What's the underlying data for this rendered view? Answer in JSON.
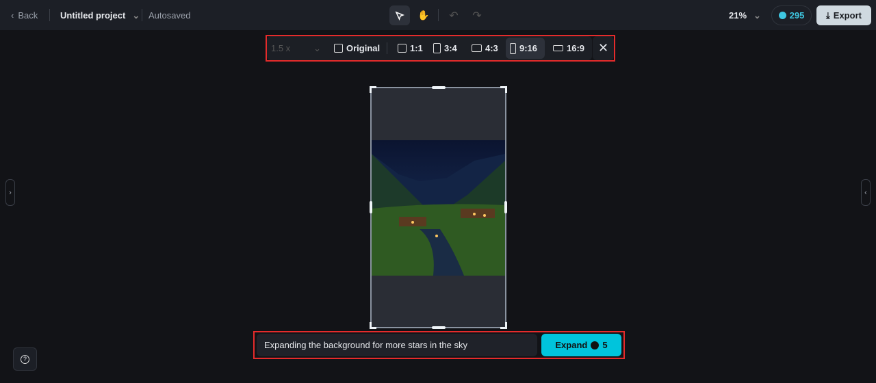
{
  "header": {
    "back_label": "Back",
    "project_title": "Untitled project",
    "save_status": "Autosaved",
    "zoom": "21%",
    "credits": "295",
    "export_label": "Export"
  },
  "tools": {
    "select": "cursor-icon",
    "pan": "hand-icon",
    "undo": "undo-icon",
    "redo": "redo-icon"
  },
  "ratio_bar": {
    "scale_value": "1.5 x",
    "options": [
      {
        "label": "Original"
      },
      {
        "label": "1:1"
      },
      {
        "label": "3:4"
      },
      {
        "label": "4:3"
      },
      {
        "label": "9:16",
        "selected": true
      },
      {
        "label": "16:9"
      }
    ]
  },
  "prompt": {
    "value": "Expanding the background for more stars in the sky",
    "expand_label": "Expand",
    "expand_cost": "5"
  },
  "colors": {
    "accent": "#00c4dc",
    "highlight": "#e52b2b"
  }
}
